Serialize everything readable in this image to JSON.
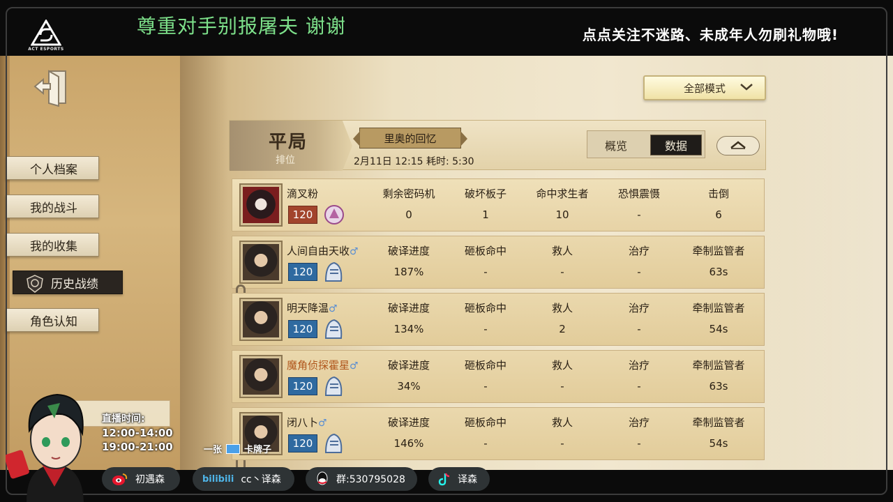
{
  "overlay": {
    "logo_text": "ACT ESPORTS",
    "banner_left": "尊重对手别报屠夫 谢谢",
    "banner_right": "点点关注不迷路、未成年人勿刷礼物哦!",
    "schedule_title": "直播时间:",
    "schedule_times": [
      "12:00-14:00",
      "19:00-21:00"
    ],
    "card_text_prefix": "一张",
    "card_text_suffix": "卡牌子",
    "socials": [
      {
        "icon": "weibo-icon",
        "label": "初遇森"
      },
      {
        "icon": "bilibili-icon",
        "brand": "bilibili",
        "label": "cc丶译森"
      },
      {
        "icon": "qq-icon",
        "label": "群:530795028"
      },
      {
        "icon": "tiktok-icon",
        "label": "译森"
      }
    ]
  },
  "sidebar": {
    "items": [
      {
        "label": "个人档案",
        "active": false
      },
      {
        "label": "我的战斗",
        "active": false
      },
      {
        "label": "我的收集",
        "active": false
      },
      {
        "label": "历史战绩",
        "active": true
      },
      {
        "label": "角色认知",
        "active": false
      }
    ]
  },
  "mode_select": {
    "value": "全部模式"
  },
  "match": {
    "result": "平局",
    "result_sub": "排位",
    "map": "里奥的回忆",
    "time": "2月11日 12:15 耗时: 5:30",
    "tabs": [
      "概览",
      "数据"
    ],
    "active_tab": "数据"
  },
  "hunter": {
    "name": "滴叉粉",
    "level": "120",
    "stats": [
      {
        "label": "剩余密码机",
        "value": "0"
      },
      {
        "label": "破坏板子",
        "value": "1"
      },
      {
        "label": "命中求生者",
        "value": "10"
      },
      {
        "label": "恐惧震慑",
        "value": "-"
      },
      {
        "label": "击倒",
        "value": "6"
      }
    ]
  },
  "survivors": [
    {
      "name": "人间自由天收",
      "gender": "♂",
      "level": "120",
      "highlight": false,
      "stats": [
        {
          "label": "破译进度",
          "value": "187%"
        },
        {
          "label": "砸板命中",
          "value": "-"
        },
        {
          "label": "救人",
          "value": "-"
        },
        {
          "label": "治疗",
          "value": "-"
        },
        {
          "label": "牵制监管者",
          "value": "63s"
        }
      ]
    },
    {
      "name": "明天降温",
      "gender": "♂",
      "level": "120",
      "highlight": false,
      "stats": [
        {
          "label": "破译进度",
          "value": "134%"
        },
        {
          "label": "砸板命中",
          "value": "-"
        },
        {
          "label": "救人",
          "value": "2"
        },
        {
          "label": "治疗",
          "value": "-"
        },
        {
          "label": "牵制监管者",
          "value": "54s"
        }
      ]
    },
    {
      "name": "魔角侦探霍星",
      "gender": "♂",
      "level": "120",
      "highlight": true,
      "stats": [
        {
          "label": "破译进度",
          "value": "34%"
        },
        {
          "label": "砸板命中",
          "value": "-"
        },
        {
          "label": "救人",
          "value": "-"
        },
        {
          "label": "治疗",
          "value": "-"
        },
        {
          "label": "牵制监管者",
          "value": "63s"
        }
      ]
    },
    {
      "name": "闭八卜",
      "gender": "♂",
      "level": "120",
      "highlight": false,
      "stats": [
        {
          "label": "破译进度",
          "value": "146%"
        },
        {
          "label": "砸板命中",
          "value": "-"
        },
        {
          "label": "救人",
          "value": "-"
        },
        {
          "label": "治疗",
          "value": "-"
        },
        {
          "label": "牵制监管者",
          "value": "54s"
        }
      ]
    }
  ]
}
